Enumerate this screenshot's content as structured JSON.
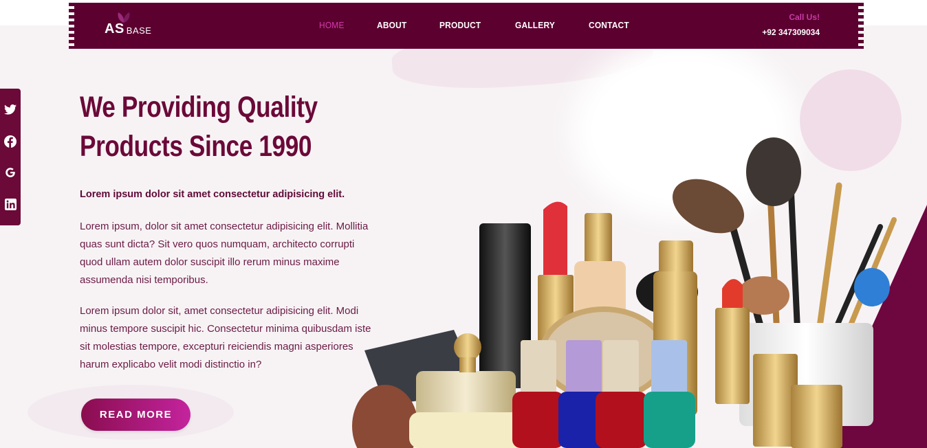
{
  "brand": {
    "logo_main": "AS",
    "logo_sub": "BASE"
  },
  "nav": {
    "items": [
      {
        "label": "HOME",
        "active": true
      },
      {
        "label": "ABOUT",
        "active": false
      },
      {
        "label": "PRODUCT",
        "active": false
      },
      {
        "label": "GALLERY",
        "active": false
      },
      {
        "label": "CONTACT",
        "active": false
      }
    ]
  },
  "call": {
    "label": "Call Us!",
    "number": "+92 347309034"
  },
  "social": {
    "icons": [
      "twitter-icon",
      "facebook-icon",
      "google-icon",
      "linkedin-icon"
    ]
  },
  "hero": {
    "title_line1": "We Providing Quality",
    "title_line2": "Products Since 1990",
    "lead": "Lorem ipsum dolor sit amet consectetur adipisicing elit.",
    "para1_lines": [
      "Lorem ipsum, dolor sit amet consectetur adipisicing elit. Mollitia",
      "quas sunt dicta? Sit vero quos numquam, architecto corrupti",
      "quod ullam autem dolor suscipit illo rerum minus maxime",
      "assumenda nisi temporibus."
    ],
    "para2_lines": [
      "Lorem ipsum dolor sit, amet consectetur adipisicing elit. Modi",
      "minus tempore suscipit hic. Consectetur minima quibusdam iste",
      "sit molestias tempore, excepturi reiciendis magni asperiores",
      "harum explicabo velit modi distinctio in?"
    ],
    "button_label": "READ MORE"
  },
  "colors": {
    "primary": "#5c0030",
    "accent": "#c93ba8",
    "text": "#6b0938"
  }
}
